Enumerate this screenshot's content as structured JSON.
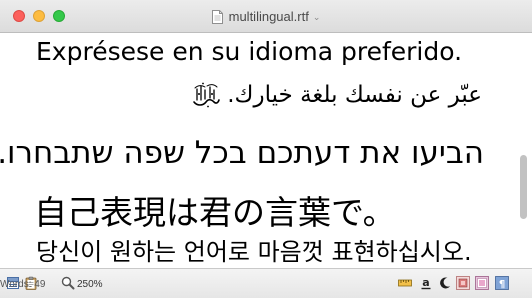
{
  "window": {
    "title": "multilingual.rtf"
  },
  "document": {
    "lines": {
      "spanish": "Exprésese en su idioma preferido.",
      "arabic": "عبّر عن نفسك بلغة خيارك.",
      "hebrew": "הביעו את דעתכם בכל שפה שתבחרו.",
      "japanese": "自己表現は君の言葉で。",
      "korean": "당신이 원하는 언어로 마음껏 표현하십시오."
    }
  },
  "statusbar": {
    "zoom": "250%",
    "words": "Words: 49"
  },
  "colors": {
    "close": "#fc605c",
    "minimize": "#fdbc40",
    "maximize": "#34c84a",
    "scroll_thumb": "#c2c2c2"
  },
  "icons": {
    "toolbar_left": [
      "layout-icon",
      "clipboard-icon",
      "magnifier-icon"
    ],
    "toolbar_right": [
      "ruler-icon",
      "underline-a-icon",
      "moon-icon",
      "color-picker-icon",
      "image-frame-icon",
      "paragraph-icon"
    ]
  }
}
